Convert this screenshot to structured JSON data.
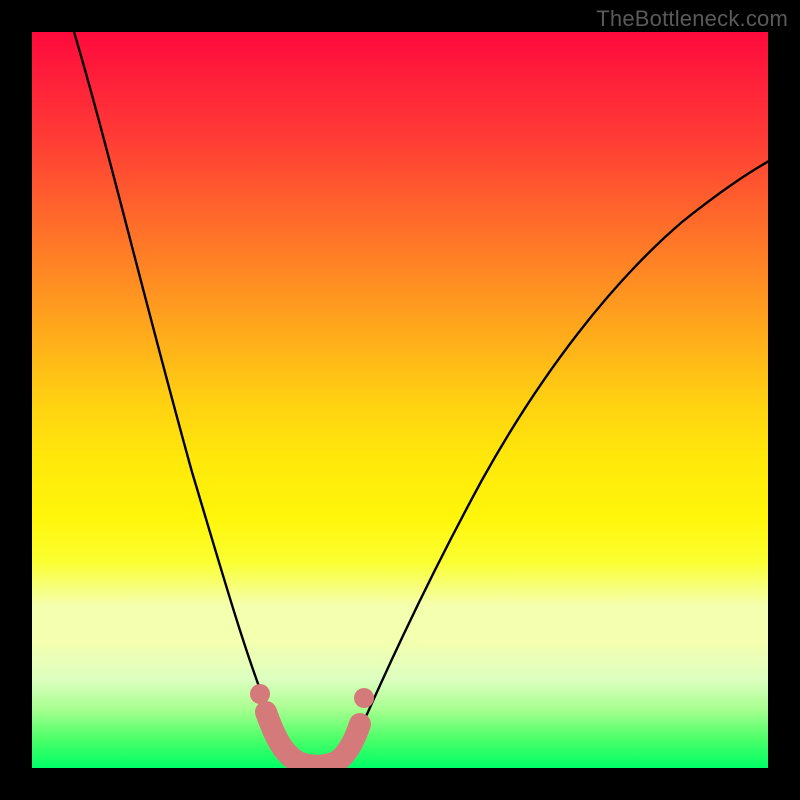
{
  "watermark": "TheBottleneck.com",
  "colors": {
    "frame": "#000000",
    "curve": "#000000",
    "marker_fill": "#d57a7a",
    "marker_stroke": "#c55e5e"
  },
  "chart_data": {
    "type": "line",
    "title": "",
    "xlabel": "",
    "ylabel": "",
    "xlim": [
      0,
      100
    ],
    "ylim": [
      0,
      100
    ],
    "grid": false,
    "description": "Qualitative bottleneck curve: two arms falling from high bottleneck at left and right toward a near-zero minimum around x≈33–40. Background heat gradient encodes bottleneck severity (red=high, green=low). Marker blob sits at the valley floor.",
    "series": [
      {
        "name": "bottleneck_percent",
        "x": [
          0,
          5,
          10,
          15,
          20,
          25,
          27,
          30,
          33,
          36,
          40,
          43,
          45,
          50,
          55,
          60,
          65,
          70,
          75,
          80,
          85,
          90,
          95,
          100
        ],
        "values": [
          100,
          90,
          78,
          64,
          48,
          30,
          22,
          12,
          4,
          1,
          1,
          4,
          8,
          18,
          27,
          35,
          42,
          49,
          55,
          61,
          66,
          70,
          73,
          76
        ]
      }
    ],
    "optimum_marker": {
      "x_range": [
        30,
        43
      ],
      "y_range": [
        0,
        12
      ]
    }
  }
}
